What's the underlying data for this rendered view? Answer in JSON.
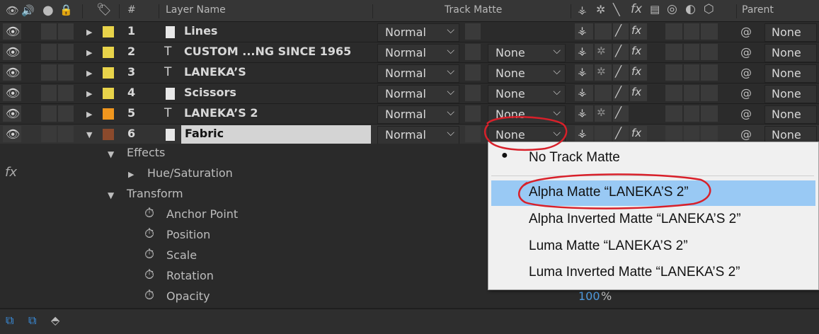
{
  "header": {
    "layer_name_label": "Layer Name",
    "number_label": "#",
    "track_matte_label": "Track Matte",
    "parent_label": "Parent"
  },
  "layers": [
    {
      "index": "1",
      "name": "Lines",
      "type": "footage",
      "label_color": "#e8d34a",
      "mode": "Normal",
      "track_matte": "",
      "parent": "None",
      "expanded": false
    },
    {
      "index": "2",
      "name": "CUSTOM ...NG SINCE 1965",
      "type": "text",
      "label_color": "#e8d34a",
      "mode": "Normal",
      "track_matte": "None",
      "parent": "None",
      "expanded": false
    },
    {
      "index": "3",
      "name": "LANEKA’S",
      "type": "text",
      "label_color": "#e8d34a",
      "mode": "Normal",
      "track_matte": "None",
      "parent": "None",
      "expanded": false
    },
    {
      "index": "4",
      "name": "Scissors",
      "type": "footage",
      "label_color": "#e8d34a",
      "mode": "Normal",
      "track_matte": "None",
      "parent": "None",
      "expanded": false
    },
    {
      "index": "5",
      "name": "LANEKA’S 2",
      "type": "text",
      "label_color": "#f0961e",
      "mode": "Normal",
      "track_matte": "None",
      "parent": "None",
      "expanded": false
    },
    {
      "index": "6",
      "name": "Fabric",
      "type": "footage",
      "label_color": "#8b4a2c",
      "mode": "Normal",
      "track_matte": "None",
      "parent": "None",
      "expanded": true
    }
  ],
  "properties": {
    "effects": "Effects",
    "hue_saturation": "Hue/Saturation",
    "transform": "Transform",
    "anchor_point": "Anchor Point",
    "position": "Position",
    "scale": "Scale",
    "rotation": "Rotation",
    "opacity": "Opacity",
    "opacity_value": "100",
    "opacity_unit": "%"
  },
  "track_matte_menu": {
    "items": [
      "No Track Matte",
      "Alpha Matte “LANEKA’S 2”",
      "Alpha Inverted Matte “LANEKA’S 2”",
      "Luma Matte “LANEKA’S 2”",
      "Luma Inverted Matte “LANEKA’S 2”"
    ],
    "checked_index": 0,
    "highlighted_index": 1
  },
  "colors": {
    "annotation": "#d8202a",
    "highlight": "#99c9f4",
    "value_blue": "#4f9be0"
  }
}
